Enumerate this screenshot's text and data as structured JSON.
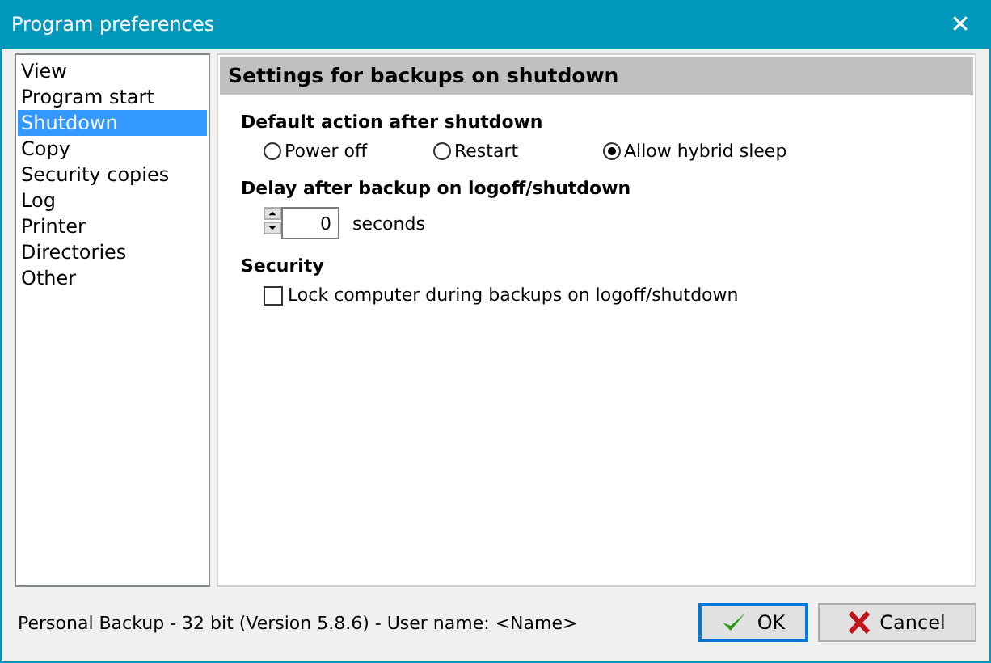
{
  "window": {
    "title": "Program preferences",
    "close": "✕"
  },
  "sidebar": {
    "items": [
      {
        "label": "View",
        "selected": false
      },
      {
        "label": "Program start",
        "selected": false
      },
      {
        "label": "Shutdown",
        "selected": true
      },
      {
        "label": "Copy",
        "selected": false
      },
      {
        "label": "Security copies",
        "selected": false
      },
      {
        "label": "Log",
        "selected": false
      },
      {
        "label": "Printer",
        "selected": false
      },
      {
        "label": "Directories",
        "selected": false
      },
      {
        "label": "Other",
        "selected": false
      }
    ]
  },
  "panel": {
    "title": "Settings for backups on shutdown",
    "sections": [
      {
        "kind": "radios",
        "heading": "Default action after shutdown",
        "options": [
          {
            "label": "Power off",
            "selected": false
          },
          {
            "label": "Restart",
            "selected": false
          },
          {
            "label": "Allow hybrid sleep",
            "selected": true
          }
        ]
      },
      {
        "kind": "spinner",
        "heading": "Delay after backup on logoff/shutdown",
        "value": "0",
        "unit": "seconds"
      },
      {
        "kind": "checkbox",
        "heading": "Security",
        "label": "Lock computer during backups on logoff/shutdown",
        "checked": false
      }
    ]
  },
  "status": "Personal Backup - 32 bit (Version 5.8.6) - User name: <Name>",
  "buttons": [
    {
      "kind": "ok",
      "label": "OK",
      "default": true
    },
    {
      "kind": "cancel",
      "label": "Cancel",
      "default": false
    }
  ]
}
